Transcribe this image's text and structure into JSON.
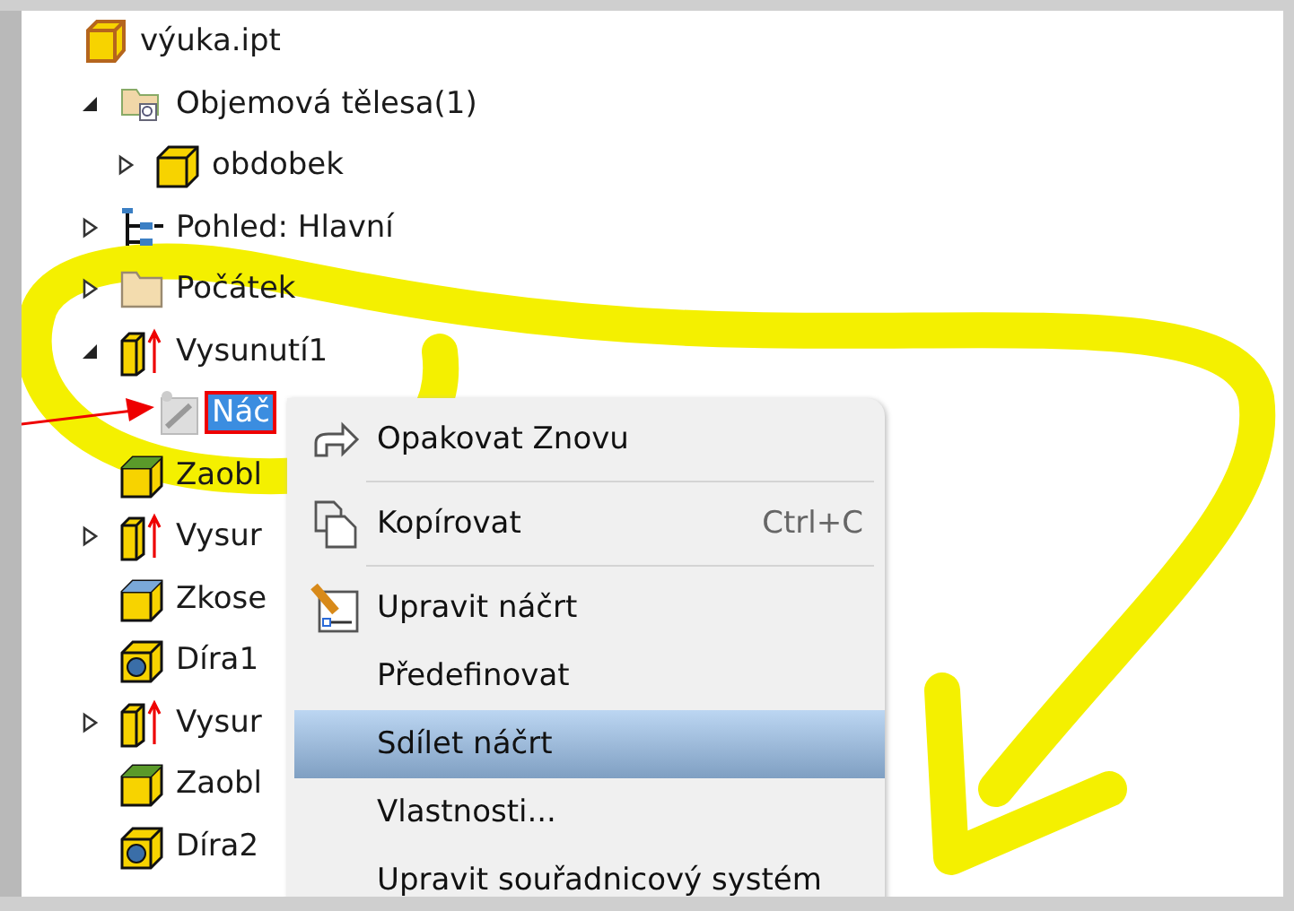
{
  "tree": [
    {
      "label": "výuka.ipt",
      "kind": "part",
      "selected": false,
      "children": [
        {
          "label": "Objemová tělesa(1)",
          "kind": "bodies",
          "selected": false,
          "expanded": true,
          "children": [
            {
              "label": "obdobek",
              "kind": "solid",
              "selected": false,
              "expanded": false
            }
          ]
        },
        {
          "label": "Pohled: Hlavní",
          "kind": "view",
          "selected": false,
          "expanded": false
        },
        {
          "label": "Počátek",
          "kind": "folder",
          "selected": false,
          "expanded": false
        },
        {
          "label": "Vysunutí1",
          "kind": "extrude",
          "selected": false,
          "expanded": true,
          "children": [
            {
              "label": "Náč",
              "kind": "sketch",
              "selected": true
            }
          ]
        },
        {
          "label": "Zaobl",
          "kind": "fillet",
          "selected": false
        },
        {
          "label": "Vysur",
          "kind": "extrude",
          "selected": false,
          "expanded": false
        },
        {
          "label": "Zkose",
          "kind": "chamfer",
          "selected": false
        },
        {
          "label": "Díra1",
          "kind": "hole",
          "selected": false
        },
        {
          "label": "Vysur",
          "kind": "extrude",
          "selected": false,
          "expanded": false
        },
        {
          "label": "Zaobl",
          "kind": "fillet",
          "selected": false
        },
        {
          "label": "Díra2",
          "kind": "hole",
          "selected": false
        }
      ]
    }
  ],
  "context_menu": {
    "items": [
      {
        "label": "Opakovat Znovu",
        "kind": "redo",
        "selected": false
      },
      {
        "kind": "separator"
      },
      {
        "label": "Kopírovat",
        "kind": "copy",
        "shortcut": "Ctrl+C",
        "selected": false
      },
      {
        "kind": "separator"
      },
      {
        "label": "Upravit náčrt",
        "kind": "edit",
        "selected": false
      },
      {
        "label": "Předefinovat",
        "selected": false
      },
      {
        "label": "Sdílet náčrt",
        "selected": true
      },
      {
        "label": "Vlastnosti...",
        "selected": false
      },
      {
        "label": "Upravit souřadnicový systém",
        "selected": false
      }
    ]
  }
}
